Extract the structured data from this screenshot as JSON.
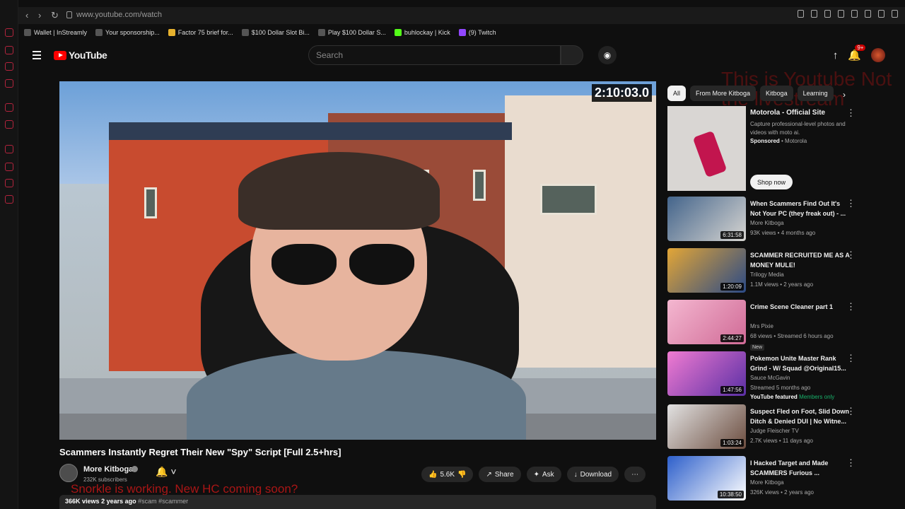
{
  "browser": {
    "url": "www.youtube.com/watch",
    "bookmarks": [
      "Wallet | InStreamly",
      "Your sponsorship...",
      "Factor 75 brief for...",
      "$100 Dollar Slot Bi...",
      "Play $100 Dollar S...",
      "buhlockay | Kick",
      "(9) Twitch"
    ]
  },
  "header": {
    "logo": "YouTube",
    "search_placeholder": "Search",
    "notifications": "9+",
    "overlay_text": "This is Youtube Not the livestream"
  },
  "video": {
    "timer": "2:10:03.0",
    "title": "Scammers Instantly Regret Their New \"Spy\" Script [Full 2.5+hrs]",
    "channel": "More Kitboga",
    "subscribers": "232K subscribers",
    "likes": "5.6K",
    "share": "Share",
    "ask": "Ask",
    "download": "Download",
    "views": "366K views",
    "age": "2 years ago",
    "hashtags": "#scam #scammer",
    "overlay_bottom": "Snorkle is working. New HC coming soon?"
  },
  "chips": [
    "All",
    "From More Kitboga",
    "Kitboga",
    "Learning"
  ],
  "ad": {
    "title": "Motorola - Official Site",
    "desc": "Capture professional-level photos and videos with moto ai.",
    "sponsored": "Sponsored",
    "advertiser": "Motorola",
    "cta": "Shop now"
  },
  "recommendations": [
    {
      "title": "When Scammers Find Out It's Not Your PC (they freak out) - ...",
      "channel": "More Kitboga",
      "meta": "93K views • 4 months ago",
      "duration": "6:31:58",
      "color": "#54708e"
    },
    {
      "title": "SCAMMER RECRUITED ME AS A MONEY MULE!",
      "channel": "Trilogy Media",
      "meta": "1.1M views • 2 years ago",
      "duration": "1:20:09",
      "color": "#c28e24"
    },
    {
      "title": "Crime Scene Cleaner part 1",
      "channel": "Mrs Pixie",
      "meta": "68 views • Streamed 6 hours ago",
      "duration": "2:44:27",
      "tag": "New",
      "color": "#e8a7c3"
    },
    {
      "title": "Pokemon Unite Master Rank Grind - W/ Squad @Original15...",
      "channel": "Sauce McGavin",
      "meta": "Streamed 5 months ago",
      "featured": "YouTube featured",
      "members": "Members only",
      "duration": "1:47:56",
      "color": "#7b3ab7"
    },
    {
      "title": "Suspect Fled on Foot, Slid Down Ditch & Denied DUI | No Witne...",
      "channel": "Judge Fleischer TV",
      "meta": "2.7K views • 11 days ago",
      "duration": "1:03:24",
      "color": "#8b5e47"
    },
    {
      "title": "I Hacked Target and Made SCAMMERS Furious ...",
      "channel": "More Kitboga",
      "meta": "326K views • 2 years ago",
      "duration": "10:38:50",
      "color": "#4178d4"
    }
  ]
}
